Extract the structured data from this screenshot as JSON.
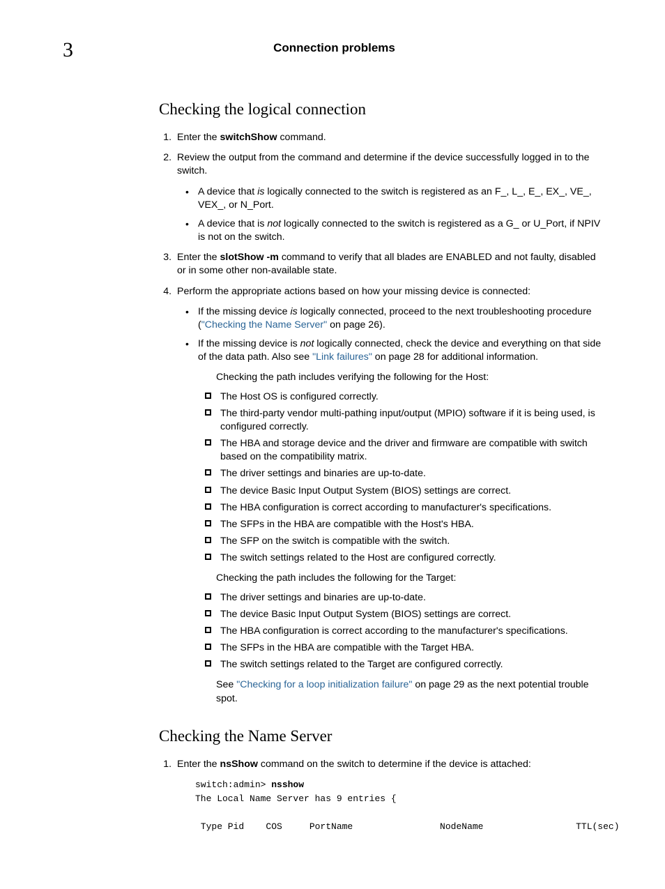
{
  "header": {
    "chapter_num": "3",
    "running_title": "Connection problems"
  },
  "section1": {
    "title": "Checking the logical connection",
    "step1_a": "Enter the ",
    "step1_bold": "switchShow",
    "step1_b": " command.",
    "step2": "Review the output from the command and determine if the device successfully logged in to the switch.",
    "step2_b1_a": "A device that ",
    "step2_b1_i": "is",
    "step2_b1_b": " logically connected to the switch is registered as an F_, L_, E_, EX_, VE_, VEX_, or N_Port.",
    "step2_b2_a": "A device that is ",
    "step2_b2_i": "not",
    "step2_b2_b": " logically connected to the switch is registered as a G_ or U_Port, if NPIV is not on the switch.",
    "step3_a": "Enter the ",
    "step3_bold": "slotShow -m",
    "step3_b": " command to verify that all blades are ENABLED and not faulty, disabled or in some other non-available state.",
    "step4": "Perform the appropriate actions based on how your missing device is connected:",
    "step4_b1_a": "If the missing device ",
    "step4_b1_i": "is",
    "step4_b1_b": " logically connected, proceed to the next troubleshooting procedure (",
    "step4_b1_link": "\"Checking the Name Server\"",
    "step4_b1_c": " on page 26).",
    "step4_b2_a": "If the missing device is ",
    "step4_b2_i": "not",
    "step4_b2_b": " logically connected, check the device and everything on that side of the data path. Also see ",
    "step4_b2_link": "\"Link failures\"",
    "step4_b2_c": " on page 28 for additional information.",
    "host_intro": "Checking the path includes verifying the following for the Host:",
    "host_checks": [
      "The Host OS is configured correctly.",
      "The third-party vendor multi-pathing input/output (MPIO) software if it is being used, is configured correctly.",
      "The HBA and storage device and the driver and firmware are compatible with switch based on the compatibility matrix.",
      "The driver settings and binaries are up-to-date.",
      "The device Basic Input Output System (BIOS) settings are correct.",
      "The HBA configuration is correct according to manufacturer's specifications.",
      "The SFPs in the HBA are compatible with the Host's HBA.",
      "The SFP on the switch is compatible with the switch.",
      "The switch settings related to the Host are configured correctly."
    ],
    "target_intro": "Checking the path includes the following for the Target:",
    "target_checks": [
      "The driver settings and binaries are up-to-date.",
      "The device Basic Input Output System (BIOS) settings are correct.",
      "The HBA configuration is correct according to the manufacturer's specifications.",
      "The SFPs in the HBA are compatible with the Target HBA.",
      "The switch settings related to the Target are configured correctly."
    ],
    "see_a": "See ",
    "see_link": "\"Checking for a loop initialization failure\"",
    "see_b": " on page 29 as the next potential trouble spot."
  },
  "section2": {
    "title": "Checking the Name Server",
    "step1_a": "Enter the ",
    "step1_bold": "nsShow",
    "step1_b": " command on the switch to determine if the device is attached:",
    "code_prompt": "switch:admin> ",
    "code_cmd": "nsshow",
    "code_line2": "The Local Name Server has 9 entries {",
    "code_header": " Type Pid    COS     PortName                NodeName                 TTL(sec)"
  }
}
